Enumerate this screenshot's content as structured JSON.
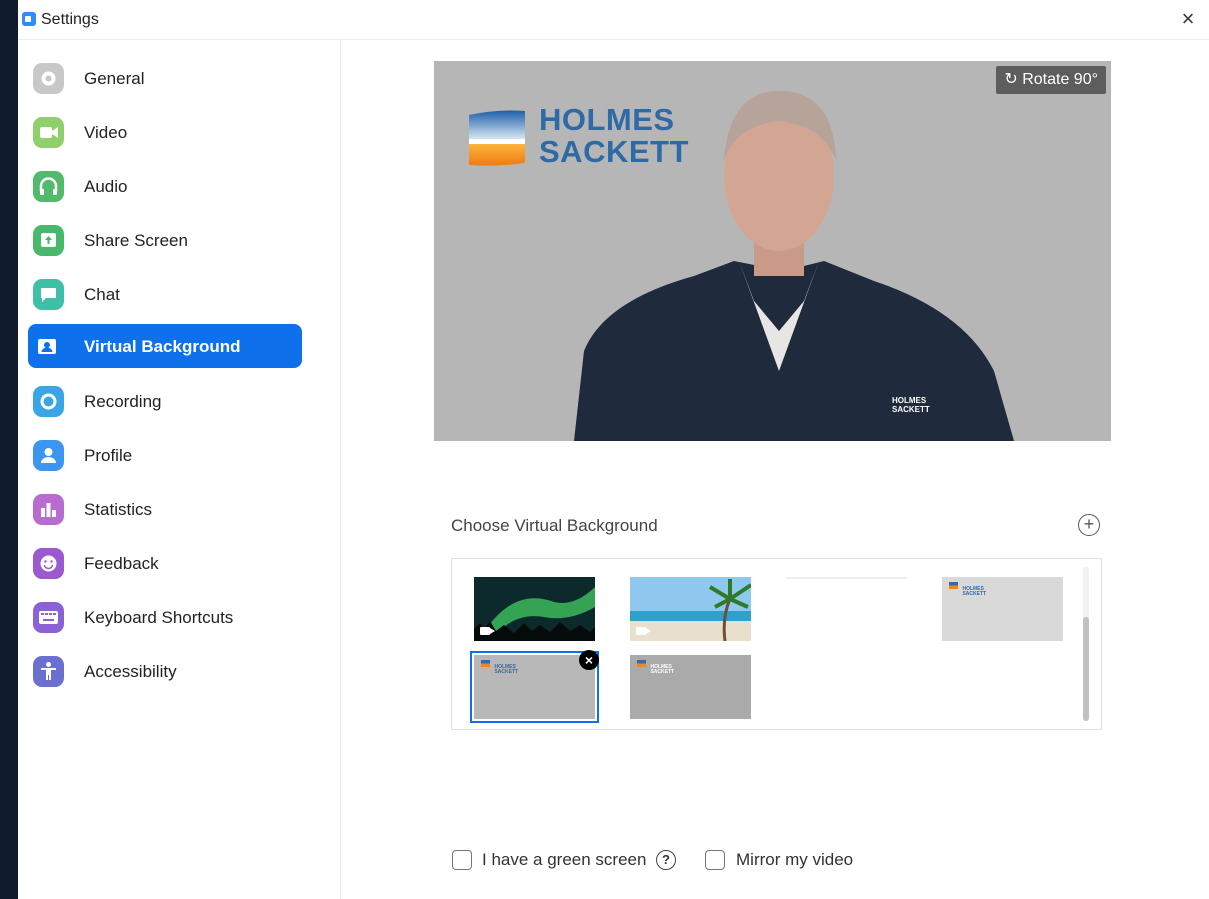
{
  "window": {
    "title": "Settings",
    "close_symbol": "×"
  },
  "sidebar": {
    "items": [
      {
        "label": "General",
        "icon": "gear-icon",
        "color": "#c8c8c8"
      },
      {
        "label": "Video",
        "icon": "video-camera-icon",
        "color": "#8fd06a"
      },
      {
        "label": "Audio",
        "icon": "headphones-icon",
        "color": "#53b96b"
      },
      {
        "label": "Share Screen",
        "icon": "share-screen-icon",
        "color": "#47b86c"
      },
      {
        "label": "Chat",
        "icon": "chat-icon",
        "color": "#3fbfa8"
      },
      {
        "label": "Virtual Background",
        "icon": "person-card-icon",
        "color": "#0e71eb",
        "active": true
      },
      {
        "label": "Recording",
        "icon": "record-icon",
        "color": "#3aa5e6"
      },
      {
        "label": "Profile",
        "icon": "profile-icon",
        "color": "#3a96f0"
      },
      {
        "label": "Statistics",
        "icon": "bar-chart-icon",
        "color": "#b86ccf"
      },
      {
        "label": "Feedback",
        "icon": "smiley-icon",
        "color": "#9b59d0"
      },
      {
        "label": "Keyboard Shortcuts",
        "icon": "keyboard-icon",
        "color": "#8b62d6"
      },
      {
        "label": "Accessibility",
        "icon": "accessibility-icon",
        "color": "#6a6fd0"
      }
    ]
  },
  "preview": {
    "rotate_label": "Rotate 90°",
    "logo_line1": "HOLMES",
    "logo_line2": "SACKETT",
    "shirt_line1": "HOLMES",
    "shirt_line2": "SACKETT"
  },
  "backgrounds": {
    "label": "Choose Virtual Background",
    "add_symbol": "+",
    "thumb_logo_line1": "HOLMES",
    "thumb_logo_line2": "SACKETT",
    "remove_symbol": "×"
  },
  "options": {
    "green_screen_label": "I have a green screen",
    "help_symbol": "?",
    "mirror_label": "Mirror my video"
  }
}
